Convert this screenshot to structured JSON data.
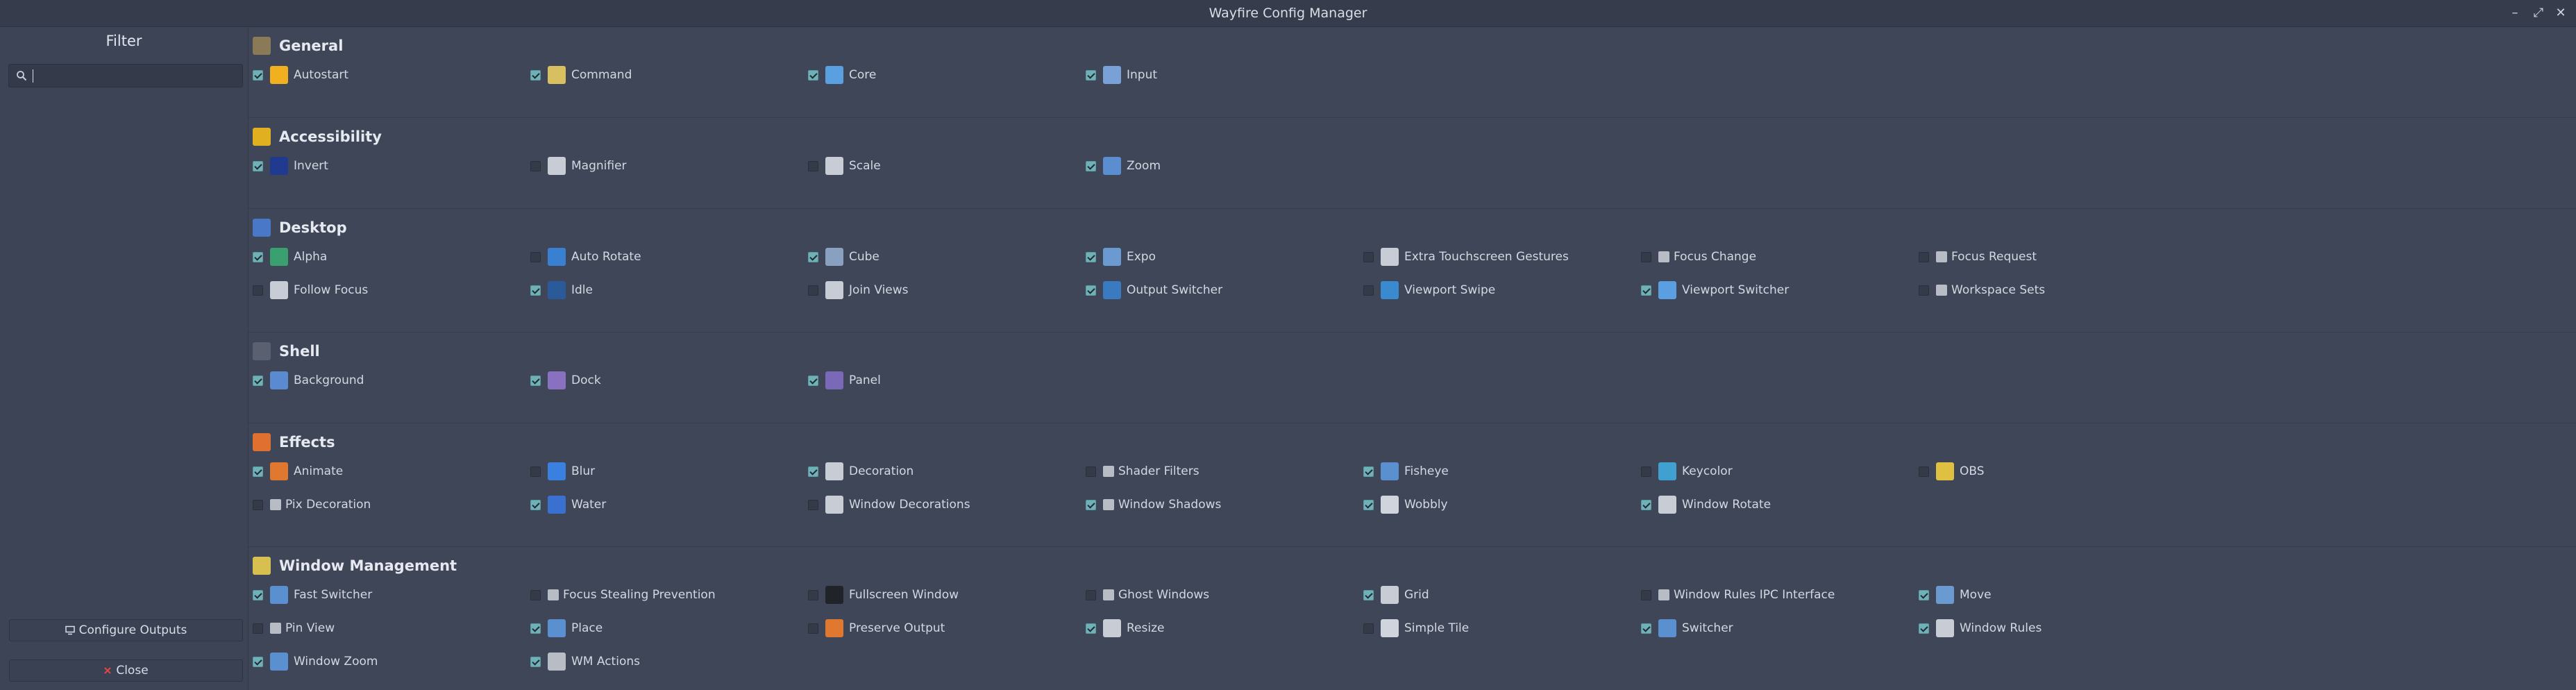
{
  "window": {
    "title": "Wayfire Config Manager",
    "minimize_glyph": "–",
    "maximize_glyph": "⤢",
    "close_glyph": "✕"
  },
  "sidebar": {
    "filter_title": "Filter",
    "search": {
      "value": "",
      "placeholder": "",
      "icon": "search-icon"
    },
    "configure_outputs": {
      "label": "Configure Outputs",
      "icon": "monitor-icon"
    },
    "close": {
      "label": "Close",
      "icon": "close-x-icon",
      "icon_color": "#e04646"
    }
  },
  "accent_color": "#70b0b7",
  "sections": [
    {
      "title": "General",
      "icon": "general-icon",
      "icon_color": "#8a7a58",
      "plugins": [
        {
          "label": "Autostart",
          "enabled": true,
          "icon": "lightning-icon",
          "color": "#f0b020"
        },
        {
          "label": "Command",
          "enabled": true,
          "icon": "command-icon",
          "color": "#d8c060"
        },
        {
          "label": "Core",
          "enabled": true,
          "icon": "core-icon",
          "color": "#5aa0e0"
        },
        {
          "label": "Input",
          "enabled": true,
          "icon": "input-icon",
          "color": "#7aa0d8"
        }
      ]
    },
    {
      "title": "Accessibility",
      "icon": "accessibility-icon",
      "icon_color": "#e0b020",
      "plugins": [
        {
          "label": "Invert",
          "enabled": true,
          "icon": "invert-icon",
          "color": "#203a90"
        },
        {
          "label": "Magnifier",
          "enabled": false,
          "icon": "magnifier-icon",
          "color": "#c8ccd4"
        },
        {
          "label": "Scale",
          "enabled": false,
          "icon": "scale-icon",
          "color": "#c8ccd4"
        },
        {
          "label": "Zoom",
          "enabled": true,
          "icon": "zoom-icon",
          "color": "#5a8ed0"
        }
      ]
    },
    {
      "title": "Desktop",
      "icon": "desktop-icon",
      "icon_color": "#4a78c8",
      "plugins": [
        {
          "label": "Alpha",
          "enabled": true,
          "icon": "alpha-icon",
          "color": "#3aa070"
        },
        {
          "label": "Auto Rotate",
          "enabled": false,
          "icon": "auto-rotate-icon",
          "color": "#3a80d0"
        },
        {
          "label": "Cube",
          "enabled": true,
          "icon": "cube-icon",
          "color": "#8aa0c0"
        },
        {
          "label": "Expo",
          "enabled": true,
          "icon": "expo-icon",
          "color": "#6a9ad0"
        },
        {
          "label": "Extra Touchscreen Gestures",
          "enabled": false,
          "icon": "touch-gestures-icon",
          "color": "#c8ccd4"
        },
        {
          "label": "Focus Change",
          "enabled": false,
          "icon": "plugin-small-icon",
          "color": "#b8bcc4"
        },
        {
          "label": "Focus Request",
          "enabled": false,
          "icon": "plugin-small-icon",
          "color": "#b8bcc4"
        },
        {
          "label": "Follow Focus",
          "enabled": false,
          "icon": "follow-focus-icon",
          "color": "#c8ccd4"
        },
        {
          "label": "Idle",
          "enabled": true,
          "icon": "idle-icon",
          "color": "#2a5a9a"
        },
        {
          "label": "Join Views",
          "enabled": false,
          "icon": "join-views-icon",
          "color": "#c8ccd4"
        },
        {
          "label": "Output Switcher",
          "enabled": true,
          "icon": "output-switcher-icon",
          "color": "#3a7ac0"
        },
        {
          "label": "Viewport Swipe",
          "enabled": false,
          "icon": "viewport-swipe-icon",
          "color": "#3a8ad0"
        },
        {
          "label": "Viewport Switcher",
          "enabled": true,
          "icon": "viewport-switcher-icon",
          "color": "#5aa0e0"
        },
        {
          "label": "Workspace Sets",
          "enabled": false,
          "icon": "plugin-small-icon",
          "color": "#b8bcc4"
        }
      ]
    },
    {
      "title": "Shell",
      "icon": "shell-icon",
      "icon_color": "#5a6070",
      "plugins": [
        {
          "label": "Background",
          "enabled": true,
          "icon": "background-icon",
          "color": "#5a8ad0"
        },
        {
          "label": "Dock",
          "enabled": true,
          "icon": "dock-icon",
          "color": "#8a70c0"
        },
        {
          "label": "Panel",
          "enabled": true,
          "icon": "panel-icon",
          "color": "#7a68b8"
        }
      ]
    },
    {
      "title": "Effects",
      "icon": "effects-icon",
      "icon_color": "#e07030",
      "plugins": [
        {
          "label": "Animate",
          "enabled": true,
          "icon": "animate-icon",
          "color": "#e07830"
        },
        {
          "label": "Blur",
          "enabled": false,
          "icon": "blur-icon",
          "color": "#3a80e0"
        },
        {
          "label": "Decoration",
          "enabled": true,
          "icon": "decoration-icon",
          "color": "#c8ccd4"
        },
        {
          "label": "Shader Filters",
          "enabled": false,
          "icon": "plugin-small-icon",
          "color": "#b8bcc4"
        },
        {
          "label": "Fisheye",
          "enabled": true,
          "icon": "fisheye-icon",
          "color": "#5a90d0"
        },
        {
          "label": "Keycolor",
          "enabled": false,
          "icon": "keycolor-icon",
          "color": "#40a0d0"
        },
        {
          "label": "OBS",
          "enabled": false,
          "icon": "obs-icon",
          "color": "#e0c040"
        },
        {
          "label": "Pix Decoration",
          "enabled": false,
          "icon": "plugin-small-icon",
          "color": "#b8bcc4"
        },
        {
          "label": "Water",
          "enabled": true,
          "icon": "water-icon",
          "color": "#3a70d0"
        },
        {
          "label": "Window Decorations",
          "enabled": false,
          "icon": "window-decorations-icon",
          "color": "#c8ccd4"
        },
        {
          "label": "Window Shadows",
          "enabled": true,
          "icon": "plugin-small-icon",
          "color": "#b8bcc4"
        },
        {
          "label": "Wobbly",
          "enabled": true,
          "icon": "wobbly-icon",
          "color": "#d0d4dc"
        },
        {
          "label": "Window Rotate",
          "enabled": true,
          "icon": "window-rotate-icon",
          "color": "#c8ccd4"
        }
      ]
    },
    {
      "title": "Window Management",
      "icon": "window-management-icon",
      "icon_color": "#d8c050",
      "plugins": [
        {
          "label": "Fast Switcher",
          "enabled": true,
          "icon": "fast-switcher-icon",
          "color": "#5a90d0"
        },
        {
          "label": "Focus Stealing Prevention",
          "enabled": false,
          "icon": "plugin-small-icon",
          "color": "#b8bcc4"
        },
        {
          "label": "Fullscreen Window",
          "enabled": false,
          "icon": "fullscreen-icon",
          "color": "#202428"
        },
        {
          "label": "Ghost Windows",
          "enabled": false,
          "icon": "plugin-small-icon",
          "color": "#b8bcc4"
        },
        {
          "label": "Grid",
          "enabled": true,
          "icon": "grid-icon",
          "color": "#c8ccd4"
        },
        {
          "label": "Window Rules IPC Interface",
          "enabled": false,
          "icon": "plugin-small-icon",
          "color": "#b8bcc4"
        },
        {
          "label": "Move",
          "enabled": true,
          "icon": "move-icon",
          "color": "#6a9ad0"
        },
        {
          "label": "Pin View",
          "enabled": false,
          "icon": "plugin-small-icon",
          "color": "#b8bcc4"
        },
        {
          "label": "Place",
          "enabled": true,
          "icon": "place-icon",
          "color": "#5a90d0"
        },
        {
          "label": "Preserve Output",
          "enabled": false,
          "icon": "preserve-output-icon",
          "color": "#e07830"
        },
        {
          "label": "Resize",
          "enabled": true,
          "icon": "resize-icon",
          "color": "#c8ccd4"
        },
        {
          "label": "Simple Tile",
          "enabled": false,
          "icon": "simple-tile-icon",
          "color": "#d0d4dc"
        },
        {
          "label": "Switcher",
          "enabled": true,
          "icon": "switcher-icon",
          "color": "#5a90d0"
        },
        {
          "label": "Window Rules",
          "enabled": true,
          "icon": "window-rules-icon",
          "color": "#c8ccd4"
        },
        {
          "label": "Window Zoom",
          "enabled": true,
          "icon": "window-zoom-icon",
          "color": "#5a90d0"
        },
        {
          "label": "WM Actions",
          "enabled": true,
          "icon": "wm-actions-icon",
          "color": "#b8bcc4"
        }
      ]
    }
  ]
}
